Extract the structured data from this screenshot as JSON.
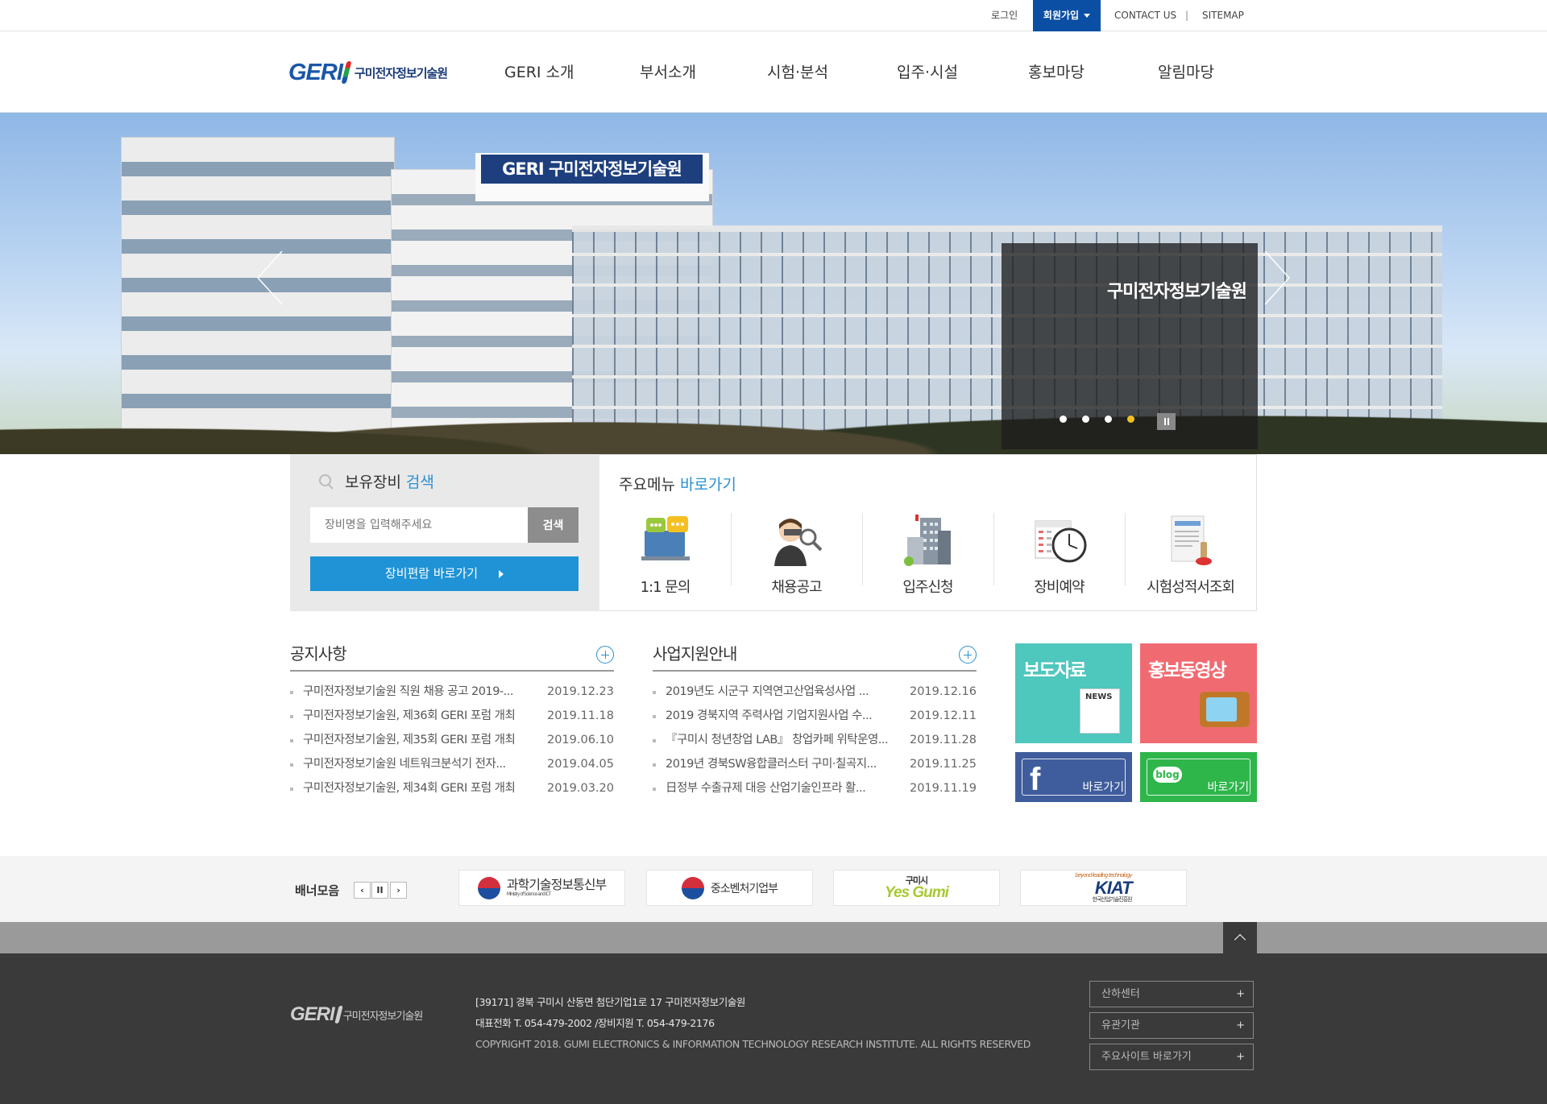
{
  "topbar": {
    "login": "로그인",
    "join": "회원가입",
    "contact": "CONTACT US",
    "separator": "|",
    "sitemap": "SITEMAP"
  },
  "header": {
    "logo_text": "GERI",
    "logo_name": "구미전자정보기술원",
    "nav": [
      "GERI 소개",
      "부서소개",
      "시험·분석",
      "입주·시설",
      "홍보마당",
      "알림마당"
    ]
  },
  "hero": {
    "sign_text": "GERI 구미전자정보기술원",
    "caption": "구미전자정보기술원",
    "active_slide": 4,
    "slide_count": 4
  },
  "equipment": {
    "title": "보유장비",
    "title_highlight": "검색",
    "placeholder": "장비명을 입력해주세요",
    "search_button": "검색",
    "shortcut": "장비편람 바로가기"
  },
  "quick_menu": {
    "title": "주요메뉴",
    "title_highlight": "바로가기",
    "items": [
      "1:1 문의",
      "채용공고",
      "입주신청",
      "장비예약",
      "시험성적서조회"
    ]
  },
  "notice": {
    "title": "공지사항",
    "items": [
      {
        "title": "구미전자정보기술원 직원 채용 공고 2019-...",
        "date": "2019.12.23"
      },
      {
        "title": "구미전자정보기술원, 제36회 GERI 포럼 개최",
        "date": "2019.11.18"
      },
      {
        "title": "구미전자정보기술원, 제35회 GERI 포럼 개최",
        "date": "2019.06.10"
      },
      {
        "title": "구미전자정보기술원 네트워크분석기 전자...",
        "date": "2019.04.05"
      },
      {
        "title": "구미전자정보기술원, 제34회 GERI 포럼 개최",
        "date": "2019.03.20"
      }
    ]
  },
  "business": {
    "title": "사업지원안내",
    "items": [
      {
        "title": "2019년도 시군구 지역연고산업육성사업 ...",
        "date": "2019.12.16"
      },
      {
        "title": "2019 경북지역 주력사업 기업지원사업 수...",
        "date": "2019.12.11"
      },
      {
        "title": "『구미시 청년창업 LAB』 창업카페 위탁운영...",
        "date": "2019.11.28"
      },
      {
        "title": "2019년 경북SW융합클러스터 구미·칠곡지...",
        "date": "2019.11.25"
      },
      {
        "title": "日정부 수출규제 대응 산업기술인프라 활...",
        "date": "2019.11.19"
      }
    ]
  },
  "promo": {
    "press": "보도자료",
    "press_news": "NEWS",
    "video": "홍보동영상",
    "facebook_go": "바로가기",
    "blog_label": "blog",
    "blog_go": "바로가기"
  },
  "banners": {
    "label": "배너모음",
    "prev": "‹",
    "pause": "II",
    "next": "›",
    "items": [
      {
        "name": "과학기술정보통신부",
        "sub": "Ministry of Science and ICT"
      },
      {
        "name": "중소벤처기업부"
      },
      {
        "name": "Yes Gumi",
        "sub": "구미시"
      },
      {
        "name": "KIAT",
        "sub": "한국산업기술진흥원",
        "tagline": "beyond leading technology"
      }
    ]
  },
  "footer": {
    "logo_text": "GERI",
    "logo_name": "구미전자정보기술원",
    "address": "[39171] 경북 구미시 산동면 첨단기업1로 17 구미전자정보기술원",
    "phone": "대표전화 T. 054-479-2002 /장비지원 T. 054-479-2176",
    "copyright": "COPYRIGHT 2018. GUMI ELECTRONICS & INFORMATION TECHNOLOGY RESEARCH INSTITUTE. ALL RIGHTS RESERVED",
    "selects": [
      "산하센터",
      "유관기관",
      "주요사이트 바로가기"
    ],
    "plus": "+"
  },
  "colors": {
    "brand_blue": "#0a4fa3",
    "accent_blue": "#1f93d6",
    "press_tile": "#4ec7bd",
    "video_tile": "#f06b71",
    "facebook_tile": "#3f5d9c",
    "blog_tile": "#2eb64b"
  }
}
